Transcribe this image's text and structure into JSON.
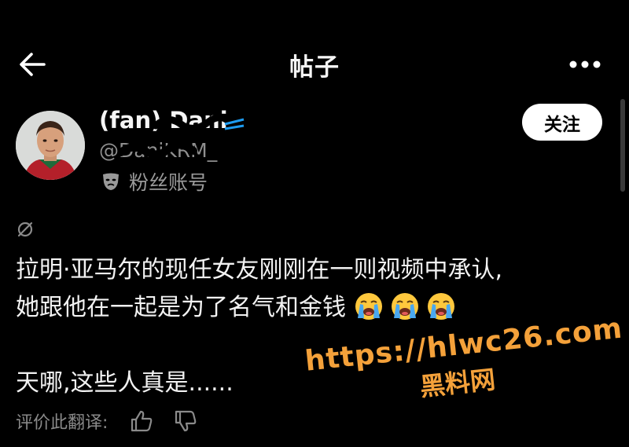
{
  "header": {
    "title": "帖子",
    "back_icon": "arrow-left-icon",
    "more_icon": "more-horizontal-icon"
  },
  "author": {
    "display_name": "(fan) Dani",
    "handle": "@DaniKRM_",
    "badge_label": "粉丝账号",
    "follow_label": "关注",
    "verified_color": "#1d9bf0"
  },
  "post": {
    "lines": [
      "拉明·亚马尔的现任女友刚刚在一则视频中承认,",
      "她跟他在一起是为了名气和金钱"
    ],
    "emoji_name": "loudly-crying-face",
    "last_line": "天哪,这些人真是......"
  },
  "translation": {
    "rate_label": "评价此翻译:"
  },
  "watermark": {
    "url": "https://hlwc26.com",
    "name": "黑料网",
    "color": "#f4a13a"
  }
}
